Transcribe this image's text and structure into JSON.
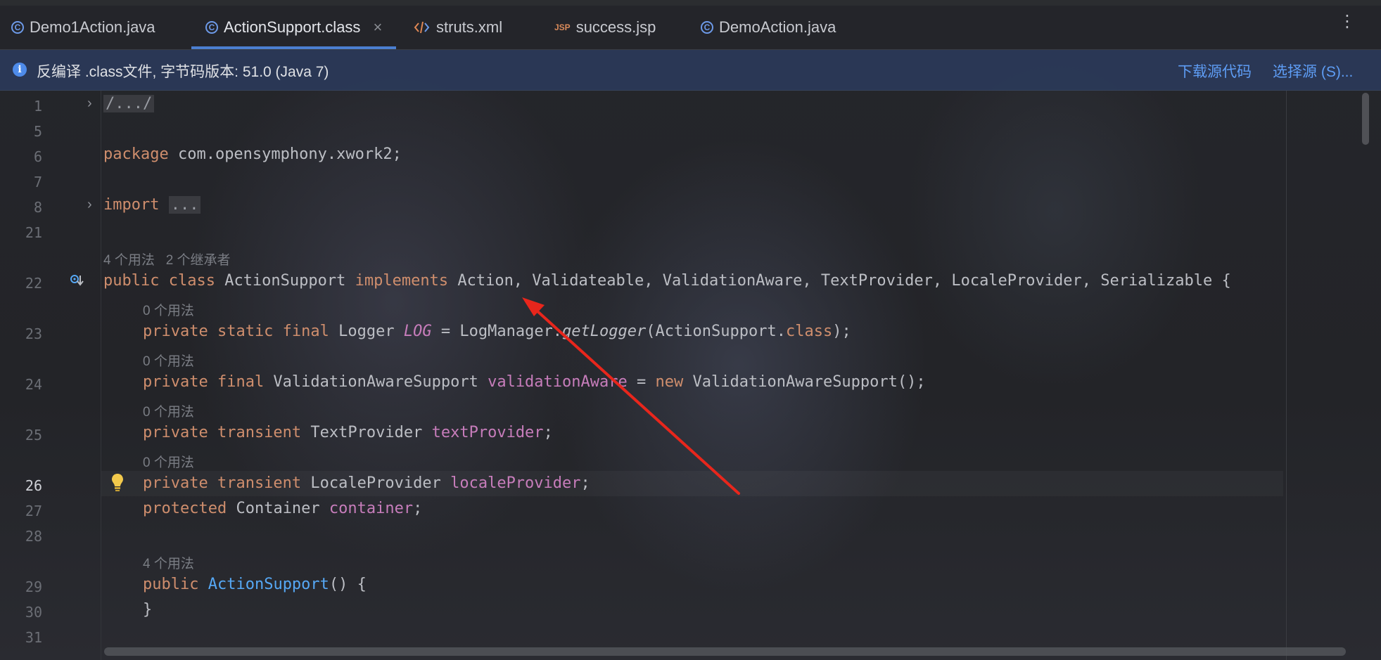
{
  "tabs": [
    {
      "label": "Demo1Action.java",
      "icon": "class-c-icon",
      "active": false
    },
    {
      "label": "ActionSupport.class",
      "icon": "class-c-icon",
      "active": true,
      "close": "×"
    },
    {
      "label": "struts.xml",
      "icon": "xml-icon",
      "active": false
    },
    {
      "label": "success.jsp",
      "icon": "jsp-icon",
      "icon_text": "JSP",
      "active": false
    },
    {
      "label": "DemoAction.java",
      "icon": "class-c-icon",
      "active": false
    }
  ],
  "tab_more": "⋮",
  "notice": {
    "message": "反编译 .class文件, 字节码版本: 51.0 (Java 7)",
    "download_link": "下载源代码",
    "choose_source_link": "选择源 (S)..."
  },
  "hints": {
    "class_usages": "4 个用法",
    "class_inheritors": "2 个继承者",
    "zero_usages": "0 个用法",
    "ctor_usages": "4 个用法"
  },
  "line_numbers": [
    "1",
    "5",
    "6",
    "7",
    "8",
    "21",
    "22",
    "23",
    "24",
    "25",
    "26",
    "27",
    "28",
    "29",
    "30",
    "31"
  ],
  "current_line": "26",
  "code": {
    "header_fold": "/.../",
    "package_kw": "package",
    "package_name": " com.opensymphony.xwork2;",
    "import_kw": "import",
    "import_fold": "...",
    "class_mods": "public class",
    "class_name": " ActionSupport ",
    "implements_kw": "implements",
    "interfaces": " Action, Validateable, ValidationAware, TextProvider, LocaleProvider, Serializable {",
    "l23_mods": "private static final",
    "l23_type": " Logger ",
    "l23_field": "LOG",
    "l23_eq": " = LogManager.",
    "l23_method": "getLogger",
    "l23_arg": "(ActionSupport.",
    "l23_class_kw": "class",
    "l23_end": ");",
    "l24_mods": "private final",
    "l24_type": " ValidationAwareSupport ",
    "l24_field": "validationAware",
    "l24_eq": " = ",
    "l24_new": "new",
    "l24_end": " ValidationAwareSupport();",
    "l25_mods": "private transient",
    "l25_type": " TextProvider ",
    "l25_field": "textProvider",
    "l25_end": ";",
    "l26_mods": "private transient",
    "l26_type": " LocaleProvider ",
    "l26_field": "localeProvider",
    "l26_end": ";",
    "l27_mods": "protected",
    "l27_type": " Container ",
    "l27_field": "container",
    "l27_end": ";",
    "l29_mods": "public",
    "l29_ctor": " ActionSupport",
    "l29_end": "() {",
    "l30": "}"
  },
  "colors": {
    "keyword": "#cf8e6d",
    "field": "#c77dbb",
    "function": "#56a8f5",
    "link": "#5e9df5",
    "arrow": "#e8261c"
  }
}
